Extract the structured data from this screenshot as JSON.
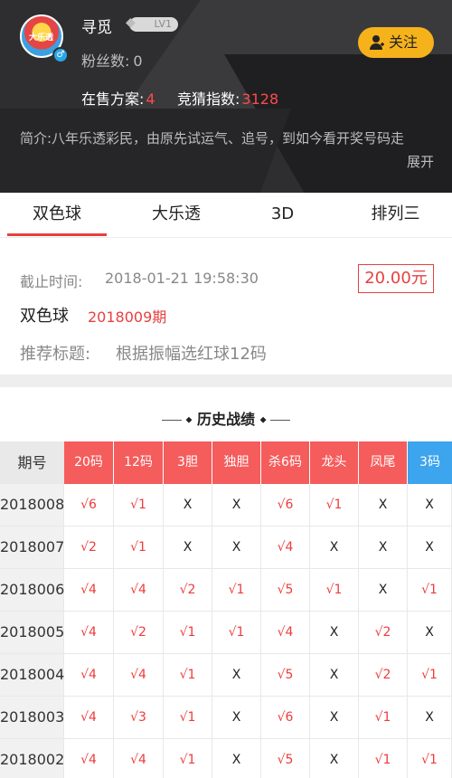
{
  "profile": {
    "username": "寻觅",
    "level": "LV1",
    "fans_label": "粉丝数:",
    "fans_count": "0",
    "avatar_text": "大乐透",
    "follow_label": "关注",
    "on_sale_label": "在售方案:",
    "on_sale_count": "4",
    "guess_index_label": "竞猜指数:",
    "guess_index_value": "3128",
    "intro_line1": "简介:八年乐透彩民，由原先试运气、追号，到如今看开奖号码走",
    "intro_line2": "展开"
  },
  "tabs": [
    {
      "label": "双色球",
      "active": true
    },
    {
      "label": "大乐透",
      "active": false
    },
    {
      "label": "3D",
      "active": false
    },
    {
      "label": "排列三",
      "active": false
    }
  ],
  "plan": {
    "deadline_label": "截止时间:",
    "deadline_value": "2018-01-21 19:58:30",
    "price": "20.00元",
    "game": "双色球",
    "issue": "2018009期",
    "recommend_label": "推荐标题:",
    "recommend_value": "根据振幅选红球12码"
  },
  "history": {
    "title": "历史战绩",
    "columns": [
      "期号",
      "20码",
      "12码",
      "3胆",
      "独胆",
      "杀6码",
      "龙头",
      "凤尾",
      "3码"
    ],
    "rows": [
      [
        "2018008",
        "√6",
        "√1",
        "X",
        "X",
        "√6",
        "√1",
        "X",
        "X"
      ],
      [
        "2018007",
        "√2",
        "√1",
        "X",
        "X",
        "√4",
        "X",
        "X",
        "X"
      ],
      [
        "2018006",
        "√4",
        "√4",
        "√2",
        "√1",
        "√5",
        "√1",
        "X",
        "√1"
      ],
      [
        "2018005",
        "√4",
        "√2",
        "√1",
        "√1",
        "√4",
        "X",
        "√2",
        "X"
      ],
      [
        "2018004",
        "√4",
        "√4",
        "√1",
        "X",
        "√5",
        "X",
        "√2",
        "√1"
      ],
      [
        "2018003",
        "√4",
        "√3",
        "√1",
        "X",
        "√6",
        "X",
        "√1",
        "X"
      ],
      [
        "2018002",
        "√4",
        "√4",
        "√1",
        "X",
        "√5",
        "X",
        "√1",
        "√1"
      ]
    ]
  },
  "colors": {
    "accent_red": "#e84040",
    "header_bg": "#2e2e30",
    "follow_yellow": "#f6b21a",
    "column_red": "#f55c5c",
    "column_blue": "#3da4ee"
  }
}
